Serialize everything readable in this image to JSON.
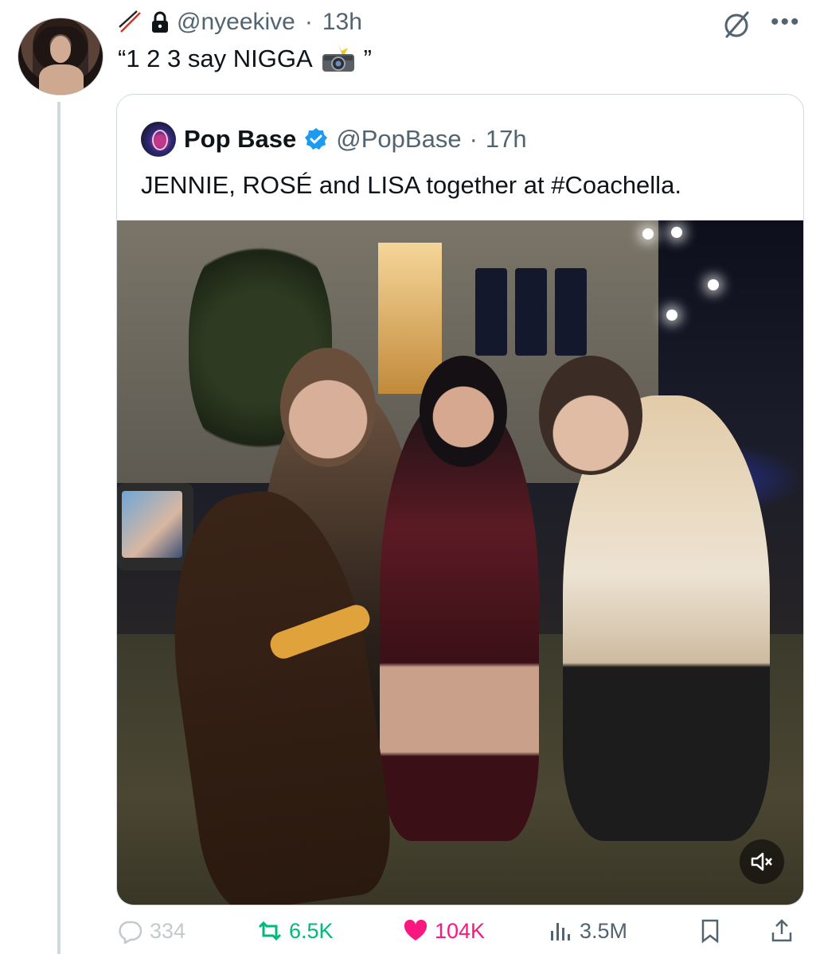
{
  "tweet": {
    "handle": "@nyeekive",
    "separator": "·",
    "time": "13h",
    "text_prefix": "“1 2 3 say NIGGA",
    "text_suffix": "”",
    "icons": [
      "chopsticks-icon",
      "lock-icon",
      "camera-flash-icon",
      "grok-icon",
      "more-icon"
    ]
  },
  "quote": {
    "name": "Pop Base",
    "handle": "@PopBase",
    "separator": "·",
    "time": "17h",
    "text": "JENNIE, ROSÉ and LISA together at #Coachella.",
    "verified_color": "#1d9bf0"
  },
  "actions": {
    "replies": "334",
    "retweets": "6.5K",
    "likes": "104K",
    "views": "3.5M"
  },
  "colors": {
    "retweet": "#00ba7c",
    "like": "#f91880",
    "muted_text": "#536471",
    "border": "#cfd9de"
  }
}
